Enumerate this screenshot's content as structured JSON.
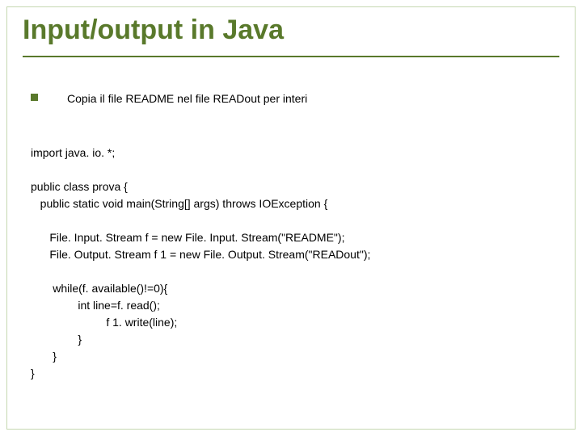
{
  "title": "Input/output in Java",
  "bullet_text": "Copia il file README nel file READout per interi",
  "code": {
    "line1": "import java. io. *;",
    "line2": "public class prova {",
    "line3": "   public static void main(String[] args) throws IOException {",
    "line4": "      File. Input. Stream f = new File. Input. Stream(\"README\");",
    "line5": "      File. Output. Stream f 1 = new File. Output. Stream(\"READout\");",
    "line6": "       while(f. available()!=0){",
    "line7": "               int line=f. read();",
    "line8": "                        f 1. write(line);",
    "line9": "               }",
    "line10": "       }",
    "line11": "}"
  }
}
